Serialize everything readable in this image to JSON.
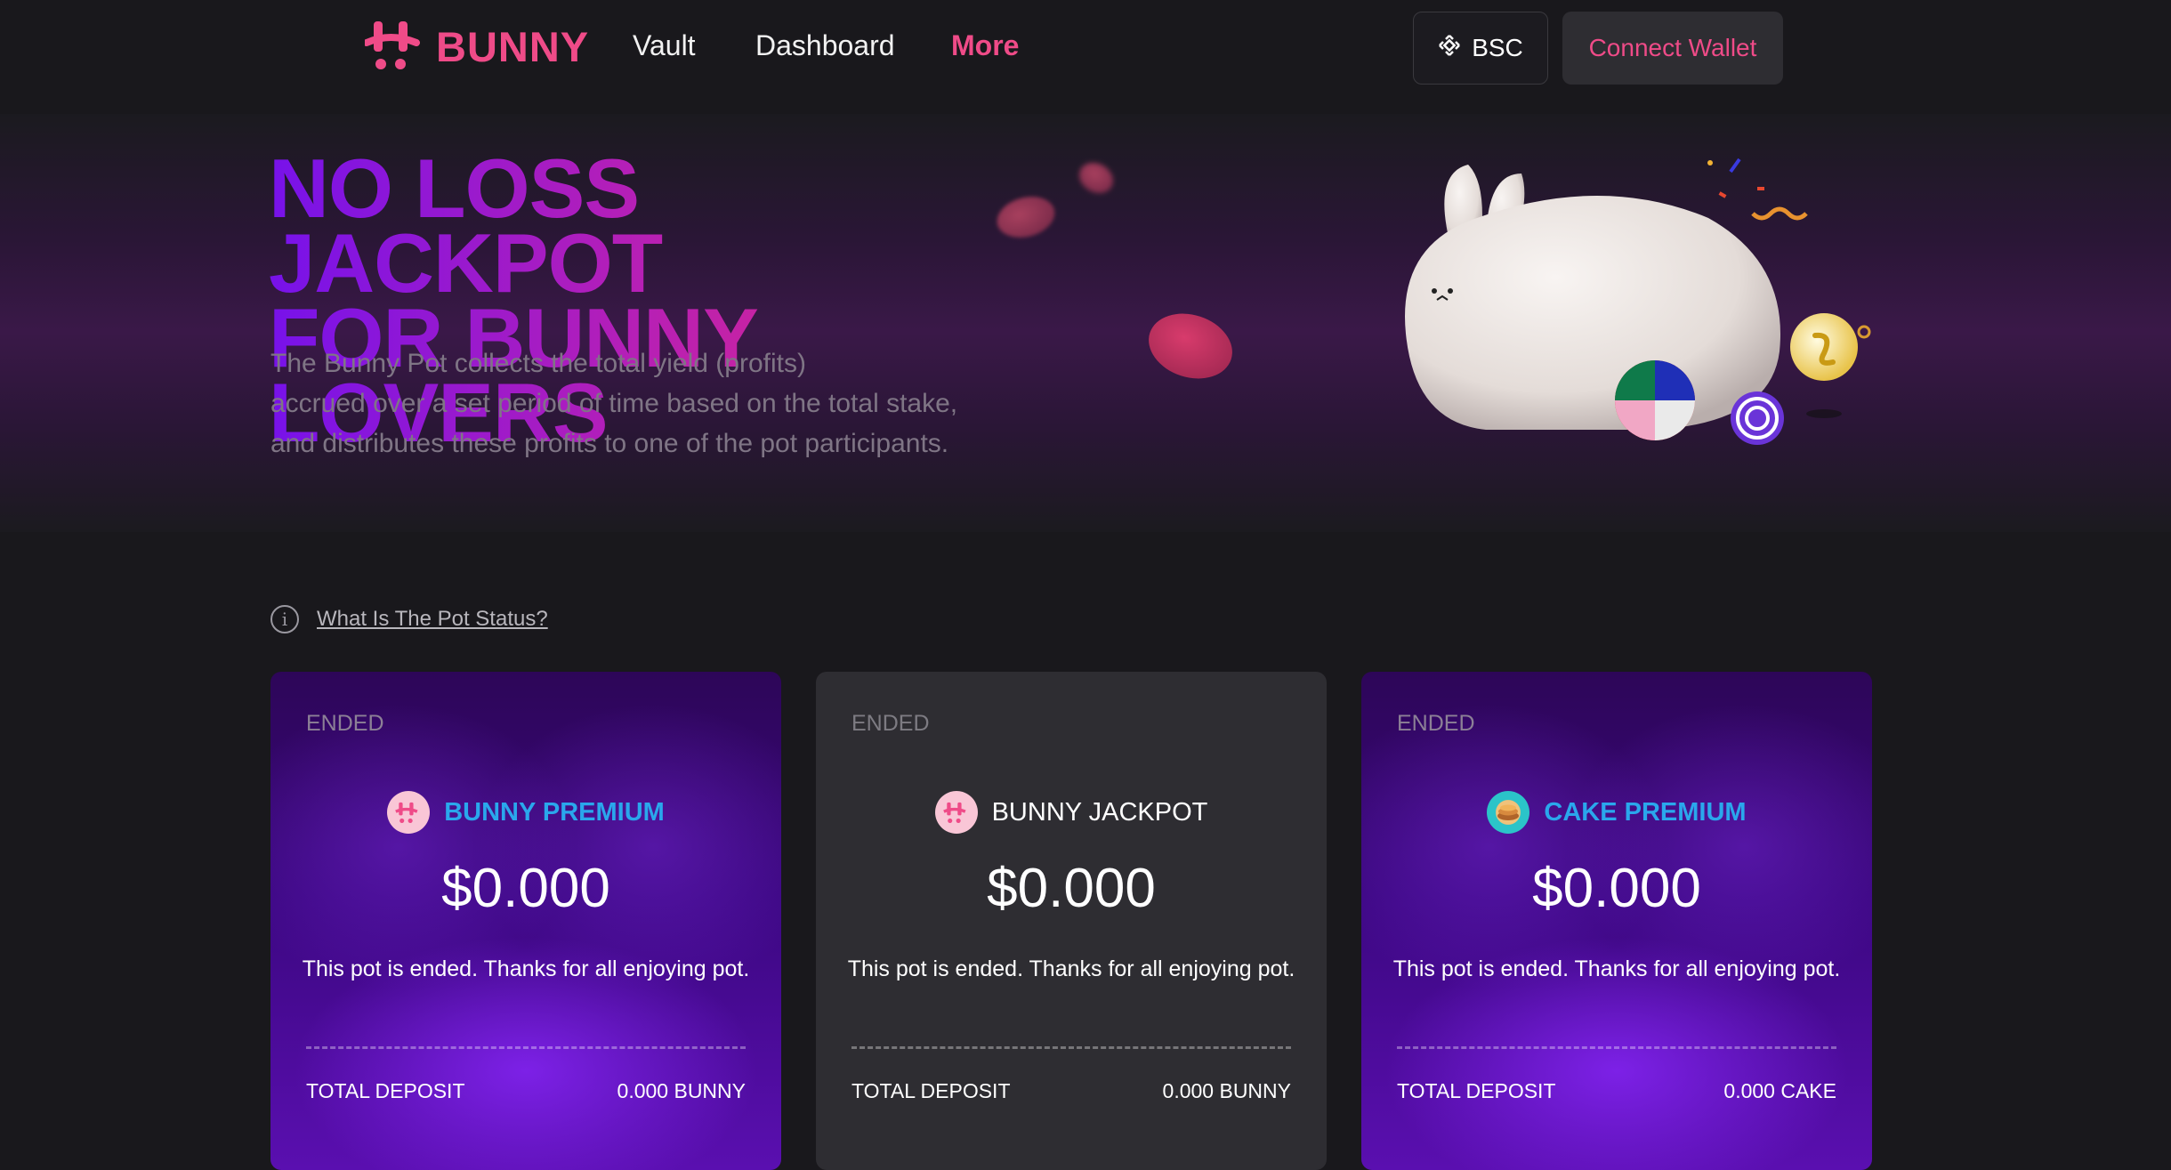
{
  "nav": {
    "brand": "BUNNY",
    "links": [
      {
        "label": "Vault"
      },
      {
        "label": "Dashboard"
      },
      {
        "label": "More"
      }
    ],
    "network_label": "BSC",
    "connect_label": "Connect Wallet",
    "accent": "#ef4b88"
  },
  "hero": {
    "title_line1": "NO LOSS JACKPOT",
    "title_line2": "FOR BUNNY LOVERS",
    "desc_line1": "The Bunny Pot collects the total yield (profits)",
    "desc_line2": "accrued over a set period of time based on the total stake,",
    "desc_line3": "and distributes these profits to one of the pot participants."
  },
  "status_link": "What Is The Pot Status?",
  "cards": [
    {
      "status": "ENDED",
      "icon": "bunny-token-icon",
      "title": "BUNNY PREMIUM",
      "amount": "$0.000",
      "message": "This pot is ended. Thanks for all enjoying pot.",
      "deposit_label": "TOTAL DEPOSIT",
      "deposit_value": "0.000 BUNNY"
    },
    {
      "status": "ENDED",
      "icon": "bunny-token-icon",
      "title": "BUNNY JACKPOT",
      "amount": "$0.000",
      "message": "This pot is ended. Thanks for all enjoying pot.",
      "deposit_label": "TOTAL DEPOSIT",
      "deposit_value": "0.000 BUNNY"
    },
    {
      "status": "ENDED",
      "icon": "cake-token-icon",
      "title": "CAKE PREMIUM",
      "amount": "$0.000",
      "message": "This pot is ended. Thanks for all enjoying pot.",
      "deposit_label": "TOTAL DEPOSIT",
      "deposit_value": "0.000 CAKE"
    }
  ]
}
